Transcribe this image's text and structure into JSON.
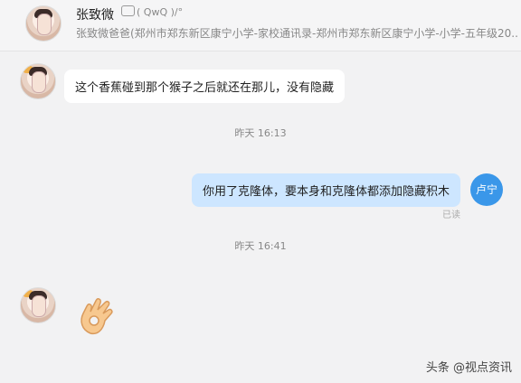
{
  "header": {
    "contact_name": "张致微",
    "status_text": "( QwQ )/°",
    "subtitle": "张致微爸爸(郑州市郑东新区康宁小学-家校通讯录-郑州市郑东新区康宁小学-小学-五年级20..."
  },
  "messages": [
    {
      "direction": "in",
      "text": "这个香蕉碰到那个猴子之后就还在那儿，没有隐藏"
    },
    {
      "direction": "time",
      "text": "昨天 16:13"
    },
    {
      "direction": "out",
      "text": "你用了克隆体，要本身和克隆体都添加隐藏积木",
      "read_status": "已读",
      "avatar_label": "卢宁"
    },
    {
      "direction": "time",
      "text": "昨天 16:41"
    },
    {
      "direction": "in",
      "emoji": "ok-hand-emoji"
    }
  ],
  "watermark": "头条 @视点资讯",
  "colors": {
    "incoming_bubble": "#ffffff",
    "outgoing_bubble": "#cde6ff",
    "self_avatar": "#3a97e9",
    "background": "#f2f2f3"
  }
}
